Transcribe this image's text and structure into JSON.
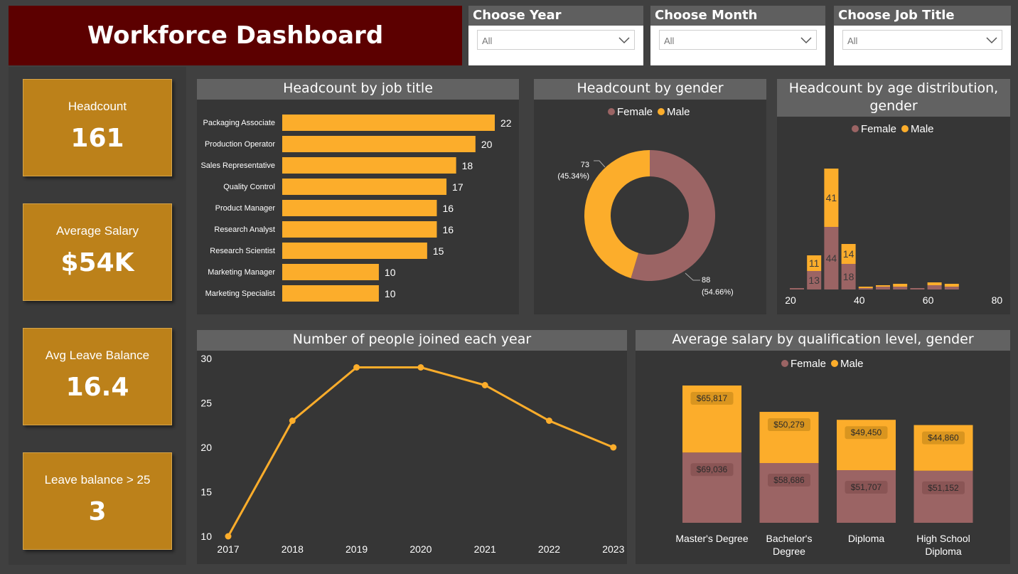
{
  "header": {
    "title": "Workforce Dashboard"
  },
  "filters": [
    {
      "label": "Choose Year",
      "value": "All"
    },
    {
      "label": "Choose Month",
      "value": "All"
    },
    {
      "label": "Choose Job Title",
      "value": "All"
    }
  ],
  "kpis": [
    {
      "label": "Headcount",
      "value": "161"
    },
    {
      "label": "Average Salary",
      "value": "$54K"
    },
    {
      "label": "Avg Leave Balance",
      "value": "16.4"
    },
    {
      "label": "Leave balance > 25",
      "value": "3"
    }
  ],
  "colors": {
    "female": "#9b6464",
    "male": "#fcad2b",
    "kpi": "#bc811a",
    "banner": "#5c0000"
  },
  "legend": {
    "female": "Female",
    "male": "Male"
  },
  "chart_data": [
    {
      "id": "jobtitle",
      "type": "bar",
      "orientation": "horizontal",
      "title": "Headcount by job title",
      "categories": [
        "Packaging Associate",
        "Production Operator",
        "Sales Representative",
        "Quality Control",
        "Product Manager",
        "Research Analyst",
        "Research Scientist",
        "Marketing Manager",
        "Marketing Specialist"
      ],
      "values": [
        22,
        20,
        18,
        17,
        16,
        16,
        15,
        10,
        10
      ]
    },
    {
      "id": "gender",
      "type": "pie",
      "title": "Headcount by gender",
      "series": [
        {
          "name": "Female",
          "value": 88,
          "label": "88",
          "pct": "(54.66%)"
        },
        {
          "name": "Male",
          "value": 73,
          "label": "73",
          "pct": "(45.34%)"
        }
      ]
    },
    {
      "id": "age",
      "type": "bar",
      "stacked": true,
      "title": "Headcount by age distribution, gender",
      "x_ticks": [
        20,
        40,
        60,
        80
      ],
      "bins": [
        {
          "x": 20,
          "female": 1,
          "male": 0
        },
        {
          "x": 25,
          "female": 13,
          "male": 11
        },
        {
          "x": 30,
          "female": 44,
          "male": 41
        },
        {
          "x": 35,
          "female": 18,
          "male": 14
        },
        {
          "x": 40,
          "female": 1,
          "male": 1
        },
        {
          "x": 45,
          "female": 2,
          "male": 1
        },
        {
          "x": 50,
          "female": 2,
          "male": 2
        },
        {
          "x": 55,
          "female": 1,
          "male": 0
        },
        {
          "x": 60,
          "female": 3,
          "male": 2
        },
        {
          "x": 65,
          "female": 2,
          "male": 2
        }
      ]
    },
    {
      "id": "joined",
      "type": "line",
      "title": "Number of people joined each year",
      "x": [
        "2017",
        "2018",
        "2019",
        "2020",
        "2021",
        "2022",
        "2023"
      ],
      "values": [
        10,
        23,
        29,
        29,
        27,
        23,
        20
      ],
      "ylim": [
        10,
        30
      ],
      "y_ticks": [
        10,
        15,
        20,
        25,
        30
      ]
    },
    {
      "id": "qualification",
      "type": "bar",
      "stacked": true,
      "title": "Average salary by qualification level, gender",
      "categories": [
        [
          "Master's Degree"
        ],
        [
          "Bachelor's",
          "Degree"
        ],
        [
          "Diploma"
        ],
        [
          "High School",
          "Diploma"
        ]
      ],
      "series": [
        {
          "name": "Female",
          "values": [
            69036,
            58686,
            51707,
            51152
          ],
          "labels": [
            "$69,036",
            "$58,686",
            "$51,707",
            "$51,152"
          ]
        },
        {
          "name": "Male",
          "values": [
            65817,
            50279,
            49450,
            44860
          ],
          "labels": [
            "$65,817",
            "$50,279",
            "$49,450",
            "$44,860"
          ]
        }
      ]
    }
  ]
}
